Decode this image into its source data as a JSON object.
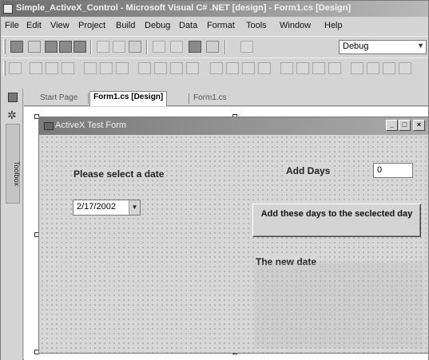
{
  "window": {
    "title": "Simple_ActiveX_Control - Microsoft Visual C# .NET [design] - Form1.cs [Design]"
  },
  "menu": [
    "File",
    "Edit",
    "View",
    "Project",
    "Build",
    "Debug",
    "Data",
    "Format",
    "Tools",
    "Window",
    "Help"
  ],
  "toolbar": {
    "configuration": "Debug"
  },
  "toolbox": {
    "label": "Toolbox"
  },
  "doc_tabs": [
    {
      "label": "Start Page",
      "active": false
    },
    {
      "label": "Form1.cs [Design]",
      "active": true
    },
    {
      "label": "Form1.cs",
      "active": false
    }
  ],
  "form": {
    "title": "ActiveX Test Form",
    "select_date_label": "Please select a date",
    "add_days_label": "Add Days",
    "days_value": "0",
    "date_value": "2/17/2002",
    "action_button_label": "Add these days to the seclected day",
    "result_label": "The new date",
    "min_glyph": "_",
    "max_glyph": "□",
    "close_glyph": "×"
  }
}
